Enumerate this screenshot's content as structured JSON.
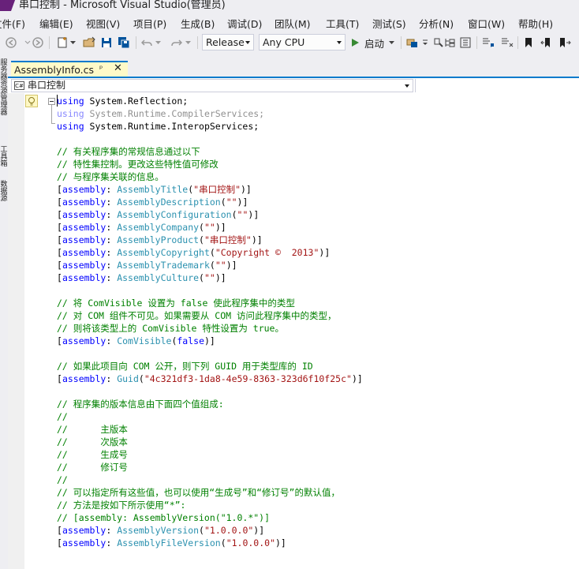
{
  "window": {
    "title": "串口控制 - Microsoft Visual Studio(管理员)"
  },
  "menu": [
    {
      "label": "文件(F)"
    },
    {
      "label": "编辑(E)"
    },
    {
      "label": "视图(V)"
    },
    {
      "label": "项目(P)"
    },
    {
      "label": "生成(B)"
    },
    {
      "label": "调试(D)"
    },
    {
      "label": "团队(M)"
    },
    {
      "label": "工具(T)"
    },
    {
      "label": "测试(S)"
    },
    {
      "label": "分析(N)"
    },
    {
      "label": "窗口(W)"
    },
    {
      "label": "帮助(H)"
    }
  ],
  "toolbar": {
    "configuration": "Release",
    "platform": "Any CPU",
    "start_label": "启动"
  },
  "side_panels": [
    "服务器资源管理器",
    "工具箱",
    "数据源"
  ],
  "tab": {
    "label": "AssemblyInfo.cs",
    "pin": "ᵖ",
    "close": "✕"
  },
  "navbar": {
    "project": "串口控制",
    "cs_badge": "C#"
  },
  "code": [
    [
      {
        "t": "kw",
        "v": "using"
      },
      {
        "t": "ns",
        "v": " System.Reflection;"
      }
    ],
    [
      {
        "t": "kw-dim",
        "v": "using"
      },
      {
        "t": "ns-dim",
        "v": " System.Runtime.CompilerServices;"
      }
    ],
    [
      {
        "t": "kw",
        "v": "using"
      },
      {
        "t": "ns",
        "v": " System.Runtime.InteropServices;"
      }
    ],
    [],
    [
      {
        "t": "cm",
        "v": "// 有关程序集的常规信息通过以下"
      }
    ],
    [
      {
        "t": "cm",
        "v": "// 特性集控制。更改这些特性值可修改"
      }
    ],
    [
      {
        "t": "cm",
        "v": "// 与程序集关联的信息。"
      }
    ],
    [
      {
        "t": "pl",
        "v": "["
      },
      {
        "t": "kw",
        "v": "assembly"
      },
      {
        "t": "pl",
        "v": ": "
      },
      {
        "t": "at",
        "v": "AssemblyTitle"
      },
      {
        "t": "pl",
        "v": "("
      },
      {
        "t": "st",
        "v": "\"串口控制\""
      },
      {
        "t": "pl",
        "v": ")]"
      }
    ],
    [
      {
        "t": "pl",
        "v": "["
      },
      {
        "t": "kw",
        "v": "assembly"
      },
      {
        "t": "pl",
        "v": ": "
      },
      {
        "t": "at",
        "v": "AssemblyDescription"
      },
      {
        "t": "pl",
        "v": "("
      },
      {
        "t": "st",
        "v": "\"\""
      },
      {
        "t": "pl",
        "v": ")]"
      }
    ],
    [
      {
        "t": "pl",
        "v": "["
      },
      {
        "t": "kw",
        "v": "assembly"
      },
      {
        "t": "pl",
        "v": ": "
      },
      {
        "t": "at",
        "v": "AssemblyConfiguration"
      },
      {
        "t": "pl",
        "v": "("
      },
      {
        "t": "st",
        "v": "\"\""
      },
      {
        "t": "pl",
        "v": ")]"
      }
    ],
    [
      {
        "t": "pl",
        "v": "["
      },
      {
        "t": "kw",
        "v": "assembly"
      },
      {
        "t": "pl",
        "v": ": "
      },
      {
        "t": "at",
        "v": "AssemblyCompany"
      },
      {
        "t": "pl",
        "v": "("
      },
      {
        "t": "st",
        "v": "\"\""
      },
      {
        "t": "pl",
        "v": ")]"
      }
    ],
    [
      {
        "t": "pl",
        "v": "["
      },
      {
        "t": "kw",
        "v": "assembly"
      },
      {
        "t": "pl",
        "v": ": "
      },
      {
        "t": "at",
        "v": "AssemblyProduct"
      },
      {
        "t": "pl",
        "v": "("
      },
      {
        "t": "st",
        "v": "\"串口控制\""
      },
      {
        "t": "pl",
        "v": ")]"
      }
    ],
    [
      {
        "t": "pl",
        "v": "["
      },
      {
        "t": "kw",
        "v": "assembly"
      },
      {
        "t": "pl",
        "v": ": "
      },
      {
        "t": "at",
        "v": "AssemblyCopyright"
      },
      {
        "t": "pl",
        "v": "("
      },
      {
        "t": "st",
        "v": "\"Copyright ©  2013\""
      },
      {
        "t": "pl",
        "v": ")]"
      }
    ],
    [
      {
        "t": "pl",
        "v": "["
      },
      {
        "t": "kw",
        "v": "assembly"
      },
      {
        "t": "pl",
        "v": ": "
      },
      {
        "t": "at",
        "v": "AssemblyTrademark"
      },
      {
        "t": "pl",
        "v": "("
      },
      {
        "t": "st",
        "v": "\"\""
      },
      {
        "t": "pl",
        "v": ")]"
      }
    ],
    [
      {
        "t": "pl",
        "v": "["
      },
      {
        "t": "kw",
        "v": "assembly"
      },
      {
        "t": "pl",
        "v": ": "
      },
      {
        "t": "at",
        "v": "AssemblyCulture"
      },
      {
        "t": "pl",
        "v": "("
      },
      {
        "t": "st",
        "v": "\"\""
      },
      {
        "t": "pl",
        "v": ")]"
      }
    ],
    [],
    [
      {
        "t": "cm",
        "v": "// 将 ComVisible 设置为 false 使此程序集中的类型"
      }
    ],
    [
      {
        "t": "cm",
        "v": "// 对 COM 组件不可见。如果需要从 COM 访问此程序集中的类型，"
      }
    ],
    [
      {
        "t": "cm",
        "v": "// 则将该类型上的 ComVisible 特性设置为 true。"
      }
    ],
    [
      {
        "t": "pl",
        "v": "["
      },
      {
        "t": "kw",
        "v": "assembly"
      },
      {
        "t": "pl",
        "v": ": "
      },
      {
        "t": "at",
        "v": "ComVisible"
      },
      {
        "t": "pl",
        "v": "("
      },
      {
        "t": "kw",
        "v": "false"
      },
      {
        "t": "pl",
        "v": ")]"
      }
    ],
    [],
    [
      {
        "t": "cm",
        "v": "// 如果此项目向 COM 公开，则下列 GUID 用于类型库的 ID"
      }
    ],
    [
      {
        "t": "pl",
        "v": "["
      },
      {
        "t": "kw",
        "v": "assembly"
      },
      {
        "t": "pl",
        "v": ": "
      },
      {
        "t": "at",
        "v": "Guid"
      },
      {
        "t": "pl",
        "v": "("
      },
      {
        "t": "st",
        "v": "\"4c321df3-1da8-4e59-8363-323d6f10f25c\""
      },
      {
        "t": "pl",
        "v": ")]"
      }
    ],
    [],
    [
      {
        "t": "cm",
        "v": "// 程序集的版本信息由下面四个值组成:"
      }
    ],
    [
      {
        "t": "cm",
        "v": "//"
      }
    ],
    [
      {
        "t": "cm",
        "v": "//      主版本"
      }
    ],
    [
      {
        "t": "cm",
        "v": "//      次版本"
      }
    ],
    [
      {
        "t": "cm",
        "v": "//      生成号"
      }
    ],
    [
      {
        "t": "cm",
        "v": "//      修订号"
      }
    ],
    [
      {
        "t": "cm",
        "v": "//"
      }
    ],
    [
      {
        "t": "cm",
        "v": "// 可以指定所有这些值，也可以使用“生成号”和“修订号”的默认值，"
      }
    ],
    [
      {
        "t": "cm",
        "v": "// 方法是按如下所示使用“*”:"
      }
    ],
    [
      {
        "t": "cm",
        "v": "// [assembly: AssemblyVersion(\"1.0.*\")]"
      }
    ],
    [
      {
        "t": "pl",
        "v": "["
      },
      {
        "t": "kw",
        "v": "assembly"
      },
      {
        "t": "pl",
        "v": ": "
      },
      {
        "t": "at",
        "v": "AssemblyVersion"
      },
      {
        "t": "pl",
        "v": "("
      },
      {
        "t": "st",
        "v": "\"1.0.0.0\""
      },
      {
        "t": "pl",
        "v": ")]"
      }
    ],
    [
      {
        "t": "pl",
        "v": "["
      },
      {
        "t": "kw",
        "v": "assembly"
      },
      {
        "t": "pl",
        "v": ": "
      },
      {
        "t": "at",
        "v": "AssemblyFileVersion"
      },
      {
        "t": "pl",
        "v": "("
      },
      {
        "t": "st",
        "v": "\"1.0.0.0\""
      },
      {
        "t": "pl",
        "v": ")]"
      }
    ]
  ],
  "colors": {
    "accent": "#007acc",
    "keyword": "#0000ff",
    "comment": "#008000",
    "type": "#2b91af",
    "string": "#a31515",
    "vs_purple": "#68217a"
  }
}
